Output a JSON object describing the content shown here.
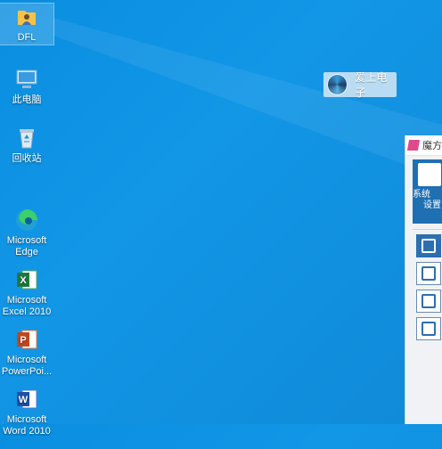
{
  "desktop": {
    "icons": [
      {
        "label": "DFL",
        "icon": "folder-user-icon"
      },
      {
        "label": "此电脑",
        "icon": "computer-icon"
      },
      {
        "label": "回收站",
        "icon": "recycle-bin-icon"
      },
      {
        "label": "Microsoft\nEdge",
        "icon": "edge-icon"
      },
      {
        "label": "Microsoft\nExcel 2010",
        "icon": "excel-icon"
      },
      {
        "label": "Microsoft\nPowerPoi...",
        "icon": "powerpoint-icon"
      },
      {
        "label": "Microsoft\nWord 2010",
        "icon": "word-icon"
      }
    ],
    "floating_label": {
      "text": "爱上电子",
      "icon": "disc-icon"
    }
  },
  "app_window": {
    "title": "魔方",
    "tile_label_line1": "系统",
    "tile_label_line2": "设置",
    "side_buttons": [
      "tool-icon",
      "monitor-clean-icon",
      "display-icon",
      "info-icon"
    ]
  }
}
